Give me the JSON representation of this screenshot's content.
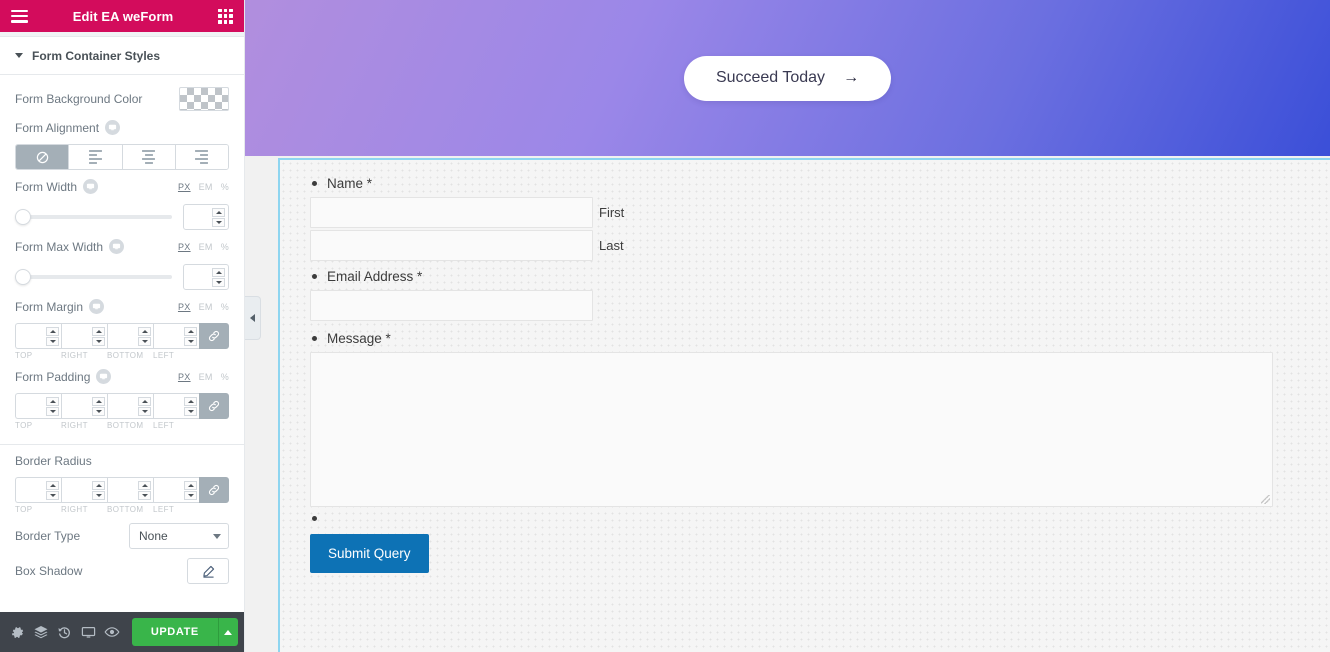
{
  "panel": {
    "header": {
      "title": "Edit EA weForm",
      "menu_icon": "hamburger-icon",
      "apps_icon": "grid-apps-icon"
    },
    "section": {
      "title": "Form Container Styles",
      "collapse_icon": "caret-down-icon"
    },
    "controls": {
      "form_background_color": {
        "label": "Form Background Color",
        "value": "transparent"
      },
      "form_alignment": {
        "label": "Form Alignment",
        "options": [
          "none",
          "left",
          "center",
          "right"
        ],
        "selected": "none",
        "responsive_icon": "device-toggle-icon"
      },
      "form_width": {
        "label": "Form Width",
        "units": [
          "PX",
          "EM",
          "%"
        ],
        "unit_selected": "PX",
        "value": "",
        "slider_percent": 0,
        "responsive_icon": "device-toggle-icon"
      },
      "form_max_width": {
        "label": "Form Max Width",
        "units": [
          "PX",
          "EM",
          "%"
        ],
        "unit_selected": "PX",
        "value": "",
        "slider_percent": 0,
        "responsive_icon": "device-toggle-icon"
      },
      "form_margin": {
        "label": "Form Margin",
        "units": [
          "PX",
          "EM",
          "%"
        ],
        "unit_selected": "PX",
        "sides": [
          "TOP",
          "RIGHT",
          "BOTTOM",
          "LEFT"
        ],
        "values": [
          "",
          "",
          "",
          ""
        ],
        "linked": true,
        "link_icon": "link-chain-icon",
        "responsive_icon": "device-toggle-icon"
      },
      "form_padding": {
        "label": "Form Padding",
        "units": [
          "PX",
          "EM",
          "%"
        ],
        "unit_selected": "PX",
        "sides": [
          "TOP",
          "RIGHT",
          "BOTTOM",
          "LEFT"
        ],
        "values": [
          "",
          "",
          "",
          ""
        ],
        "linked": true,
        "link_icon": "link-chain-icon",
        "responsive_icon": "device-toggle-icon"
      },
      "border_radius": {
        "label": "Border Radius",
        "sides": [
          "TOP",
          "RIGHT",
          "BOTTOM",
          "LEFT"
        ],
        "values": [
          "",
          "",
          "",
          ""
        ],
        "linked": true,
        "link_icon": "link-chain-icon"
      },
      "border_type": {
        "label": "Border Type",
        "value": "None",
        "options": [
          "None"
        ],
        "chevron_icon": "chevron-down-icon"
      },
      "box_shadow": {
        "label": "Box Shadow",
        "edit_icon": "pencil-edit-icon"
      }
    },
    "footer": {
      "tools": [
        {
          "name": "settings-gear-icon",
          "label": "Settings"
        },
        {
          "name": "navigator-layers-icon",
          "label": "Navigator"
        },
        {
          "name": "history-revisions-icon",
          "label": "History"
        },
        {
          "name": "responsive-mode-icon",
          "label": "Responsive Mode"
        },
        {
          "name": "preview-eye-icon",
          "label": "Preview Changes"
        }
      ],
      "update_label": "UPDATE",
      "update_arrow_icon": "caret-up-icon",
      "update_color": "#39b54a"
    },
    "collapse_handle": {
      "icon": "chevron-left-icon"
    }
  },
  "canvas": {
    "hero": {
      "button_label": "Succeed Today",
      "button_arrow": "→",
      "gradient_from": "#b18ede",
      "gradient_to": "#3b4fd8"
    },
    "form": {
      "selection_border_color": "#8ed5f0",
      "fields": [
        {
          "label": "Name *",
          "type": "name",
          "subfields": [
            {
              "value": "",
              "sub_label": "First"
            },
            {
              "value": "",
              "sub_label": "Last"
            }
          ]
        },
        {
          "label": "Email Address *",
          "type": "text",
          "value": ""
        },
        {
          "label": "Message *",
          "type": "textarea",
          "value": "",
          "resize_icon": "resize-grip-icon"
        }
      ],
      "submit": {
        "label": "Submit Query",
        "color": "#0d72b5"
      }
    }
  }
}
